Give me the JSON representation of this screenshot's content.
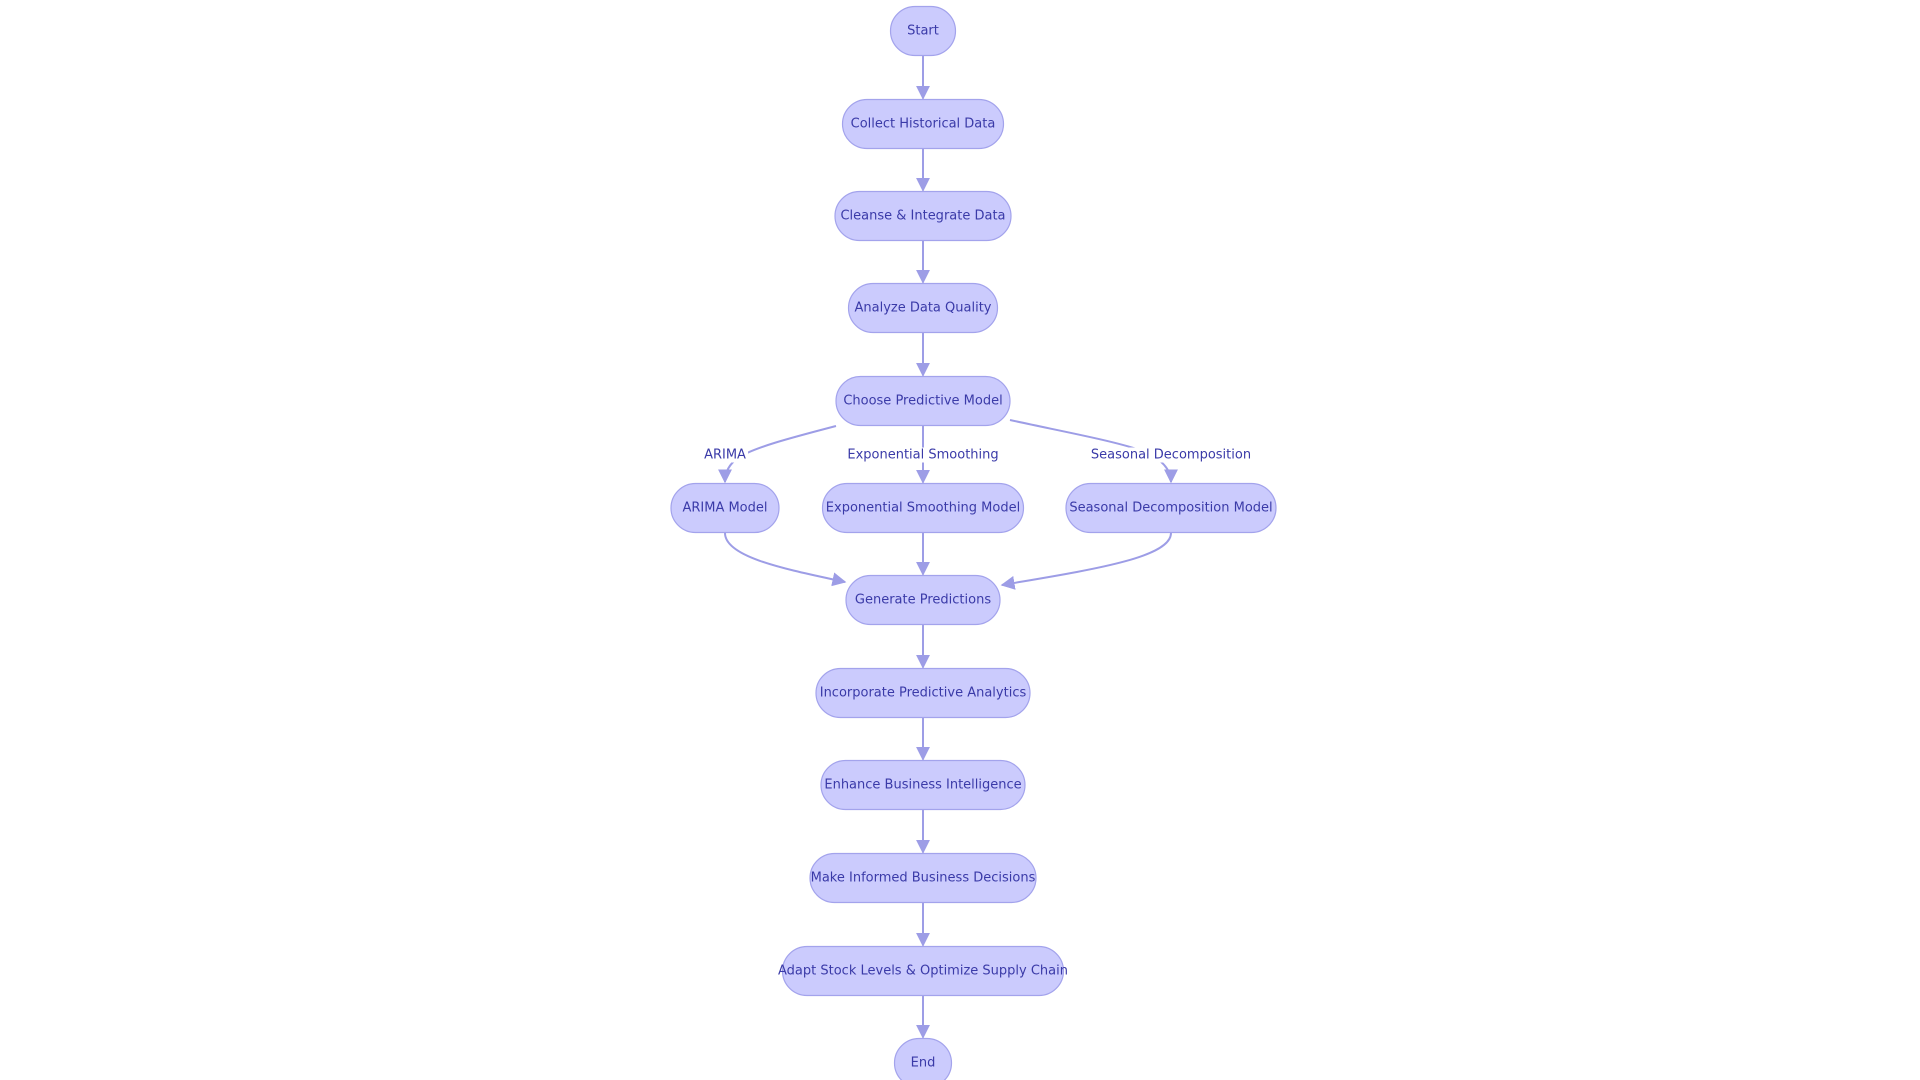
{
  "diagram": {
    "type": "flowchart",
    "colors": {
      "node_fill": "#cbcbfd",
      "node_stroke": "#a3a3ec",
      "text": "#3a3aa8",
      "edge": "#9d9de6"
    },
    "nodes": [
      {
        "id": "start",
        "label": "Start"
      },
      {
        "id": "collect",
        "label": "Collect Historical Data"
      },
      {
        "id": "cleanse",
        "label": "Cleanse & Integrate Data"
      },
      {
        "id": "analyze",
        "label": "Analyze Data Quality"
      },
      {
        "id": "choose",
        "label": "Choose Predictive Model"
      },
      {
        "id": "arima",
        "label": "ARIMA Model"
      },
      {
        "id": "exp",
        "label": "Exponential Smoothing Model"
      },
      {
        "id": "seasonal",
        "label": "Seasonal Decomposition Model"
      },
      {
        "id": "generate",
        "label": "Generate Predictions"
      },
      {
        "id": "incorporate",
        "label": "Incorporate Predictive Analytics"
      },
      {
        "id": "enhance",
        "label": "Enhance Business Intelligence"
      },
      {
        "id": "decide",
        "label": "Make Informed Business Decisions"
      },
      {
        "id": "adapt",
        "label": "Adapt Stock Levels & Optimize Supply Chain"
      },
      {
        "id": "end",
        "label": "End"
      }
    ],
    "edges": [
      {
        "from": "start",
        "to": "collect",
        "label": ""
      },
      {
        "from": "collect",
        "to": "cleanse",
        "label": ""
      },
      {
        "from": "cleanse",
        "to": "analyze",
        "label": ""
      },
      {
        "from": "analyze",
        "to": "choose",
        "label": ""
      },
      {
        "from": "choose",
        "to": "arima",
        "label": "ARIMA"
      },
      {
        "from": "choose",
        "to": "exp",
        "label": "Exponential Smoothing"
      },
      {
        "from": "choose",
        "to": "seasonal",
        "label": "Seasonal Decomposition"
      },
      {
        "from": "arima",
        "to": "generate",
        "label": ""
      },
      {
        "from": "exp",
        "to": "generate",
        "label": ""
      },
      {
        "from": "seasonal",
        "to": "generate",
        "label": ""
      },
      {
        "from": "generate",
        "to": "incorporate",
        "label": ""
      },
      {
        "from": "incorporate",
        "to": "enhance",
        "label": ""
      },
      {
        "from": "enhance",
        "to": "decide",
        "label": ""
      },
      {
        "from": "decide",
        "to": "adapt",
        "label": ""
      },
      {
        "from": "adapt",
        "to": "end",
        "label": ""
      }
    ]
  }
}
